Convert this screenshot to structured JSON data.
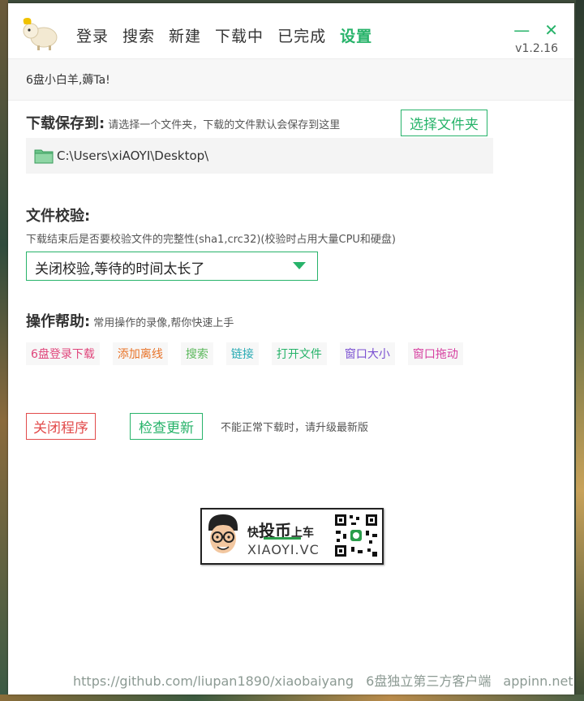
{
  "colors": {
    "accent": "#27b36a",
    "danger": "#e24b4b"
  },
  "nav": [
    {
      "label": "登录",
      "active": false
    },
    {
      "label": "搜索",
      "active": false
    },
    {
      "label": "新建",
      "active": false
    },
    {
      "label": "下载中",
      "active": false
    },
    {
      "label": "已完成",
      "active": false
    },
    {
      "label": "设置",
      "active": true
    }
  ],
  "window": {
    "minimize": "—",
    "close": "✕",
    "version": "v1.2.16"
  },
  "greeting": "6盘小白羊,薅Ta!",
  "download": {
    "title": "下载保存到:",
    "desc": "请选择一个文件夹，下载的文件默认会保存到这里",
    "choose_button": "选择文件夹",
    "path": "C:\\Users\\xiAOYI\\Desktop\\",
    "folder_icon": "folder-icon"
  },
  "verify": {
    "title": "文件校验:",
    "desc": "下载结束后是否要校验文件的完整性(sha1,crc32)(校验时占用大量CPU和硬盘)",
    "selected": "关闭校验,等待的时间太长了"
  },
  "help": {
    "title": "操作帮助:",
    "desc": "常用操作的录像,帮你快速上手",
    "tags": [
      {
        "label": "6盘登录下载",
        "color": "#e0457b"
      },
      {
        "label": "添加离线",
        "color": "#e8742a"
      },
      {
        "label": "搜索",
        "color": "#5cb85c"
      },
      {
        "label": "链接",
        "color": "#27aab3"
      },
      {
        "label": "打开文件",
        "color": "#27b36a"
      },
      {
        "label": "窗口大小",
        "color": "#7a4fd1"
      },
      {
        "label": "窗口拖动",
        "color": "#d63fa0"
      }
    ]
  },
  "actions": {
    "close_program": "关闭程序",
    "check_update": "检查更新",
    "hint": "不能正常下载时，请升级最新版"
  },
  "badge": {
    "line1_a": "快",
    "line1_b": "投币",
    "line1_c": "上车",
    "line2": "XIAOYI.VC"
  },
  "footer": {
    "github": "https://github.com/liupan1890/xiaobaiyang",
    "desc": "6盘独立第三方客户端",
    "site": "appinn.net"
  }
}
